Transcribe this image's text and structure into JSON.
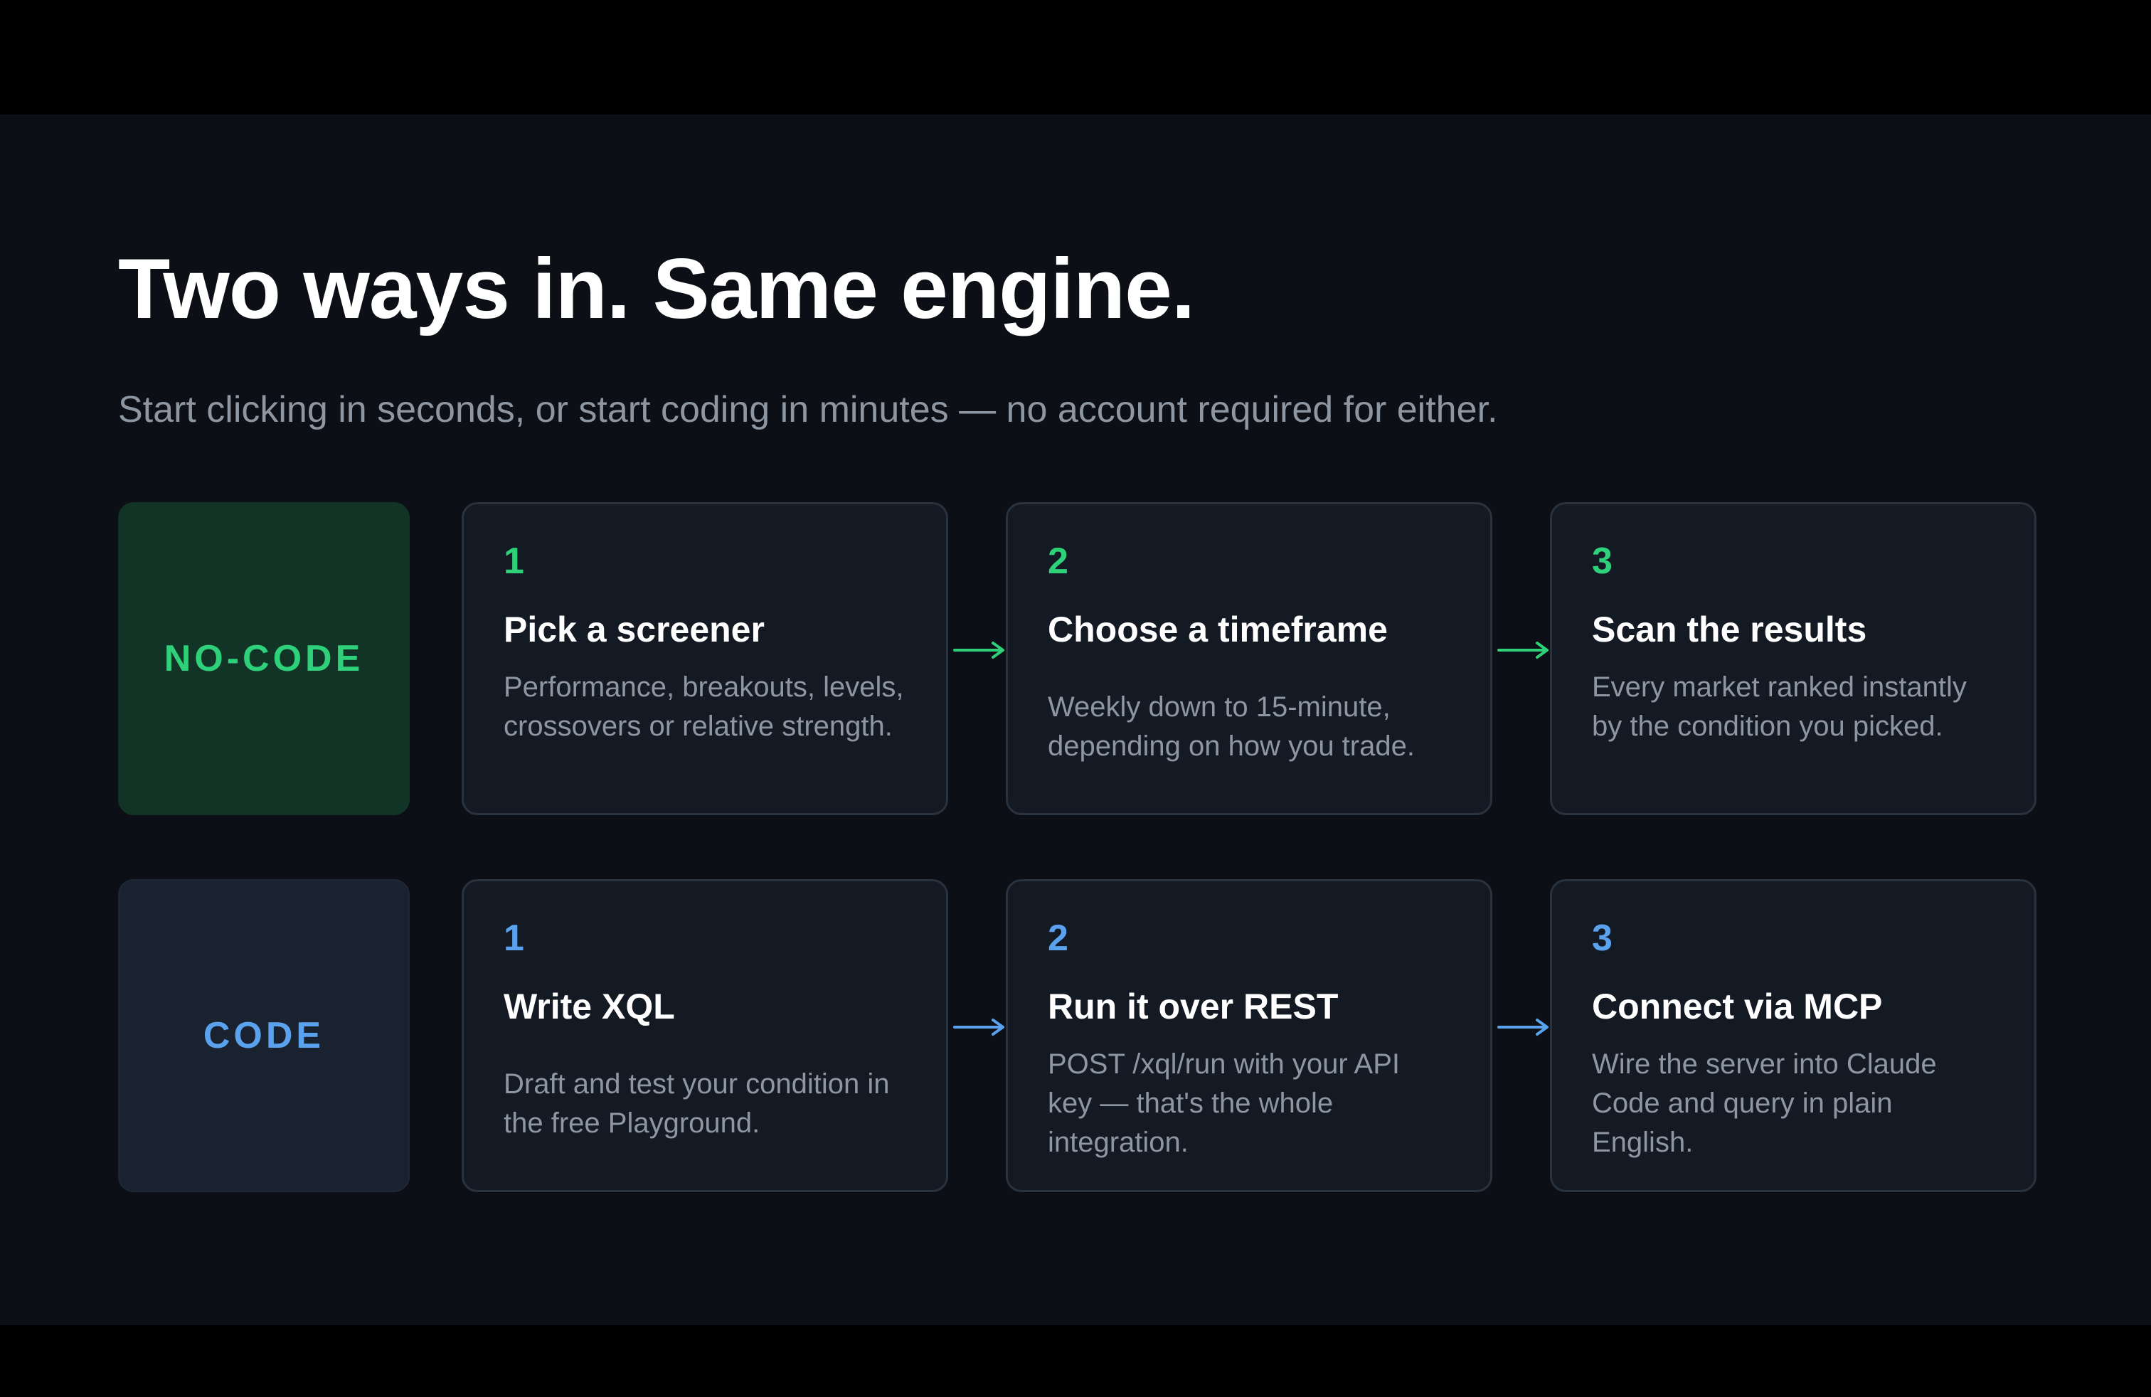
{
  "title": "Two ways in. Same engine.",
  "subtitle": "Start clicking in seconds, or start coding in minutes — no account required for either.",
  "colors": {
    "nocode_accent": "#2fd07a",
    "code_accent": "#5aa2ee",
    "background": "#0c1016"
  },
  "rows": {
    "nocode": {
      "label": "NO-CODE",
      "steps": [
        {
          "number": "1",
          "title": "Pick a screener",
          "desc": "Performance, breakouts, levels, crossovers or relative strength."
        },
        {
          "number": "2",
          "title": "Choose a timeframe",
          "desc": "Weekly down to 15-minute, depending on how you trade."
        },
        {
          "number": "3",
          "title": "Scan the results",
          "desc": "Every market ranked instantly by the condition you picked."
        }
      ],
      "arrows": [
        "→",
        "→"
      ]
    },
    "code": {
      "label": "CODE",
      "steps": [
        {
          "number": "1",
          "title": "Write XQL",
          "desc": "Draft and test your condition in the free Playground."
        },
        {
          "number": "2",
          "title": "Run it over REST",
          "desc": "POST /xql/run with your API key — that's the whole integration."
        },
        {
          "number": "3",
          "title": "Connect via MCP",
          "desc": "Wire the server into Claude Code and query in plain English."
        }
      ],
      "arrows": [
        "→",
        "→"
      ]
    }
  }
}
